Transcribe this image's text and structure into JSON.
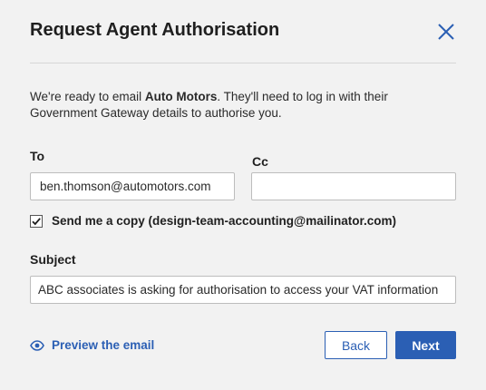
{
  "dialog": {
    "title": "Request Agent Authorisation",
    "intro_prefix": "We're ready to email ",
    "client_name": "Auto Motors",
    "intro_suffix": ". They'll need to log in with their Government Gateway details to authorise you."
  },
  "form": {
    "to_label": "To",
    "to_value": "ben.thomson@automotors.com",
    "cc_label": "Cc",
    "cc_value": "",
    "send_copy_checked": true,
    "send_copy_label": "Send me a copy (design-team-accounting@mailinator.com)",
    "subject_label": "Subject",
    "subject_value": "ABC associates is asking for authorisation to access your VAT information"
  },
  "footer": {
    "preview_label": "Preview the email",
    "back_label": "Back",
    "next_label": "Next"
  },
  "colors": {
    "accent": "#2b5fb4",
    "background": "#f2f2f2"
  },
  "icons": {
    "close": "close-icon",
    "preview": "eye-icon",
    "checkbox": "checkmark-icon"
  }
}
